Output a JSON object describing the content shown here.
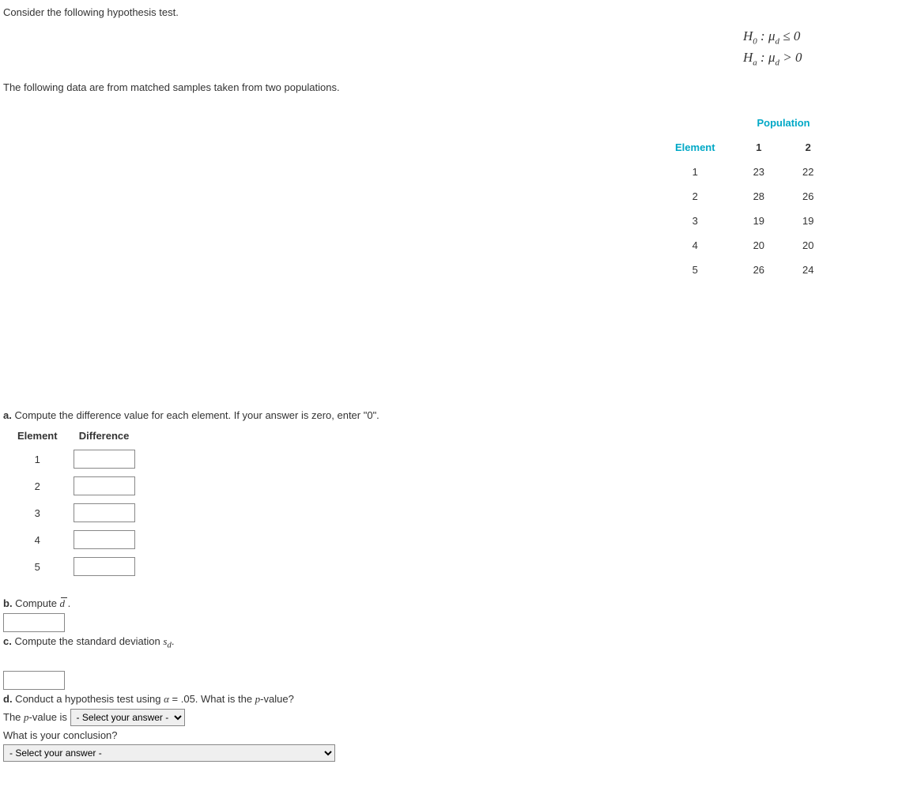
{
  "intro1": "Consider the following hypothesis test.",
  "intro2": "The following data are from matched samples taken from two populations.",
  "hypotheses": {
    "h0_prefix": "H",
    "h0_sub": "0",
    "h0_colon": " : ",
    "mu": "μ",
    "d_sub": "d",
    "h0_rel": " ≤ 0",
    "ha_prefix": "H",
    "ha_sub": "a",
    "ha_rel": " > 0"
  },
  "table": {
    "element_head": "Element",
    "population_head": "Population",
    "col1": "1",
    "col2": "2",
    "rows": [
      {
        "el": "1",
        "p1": "23",
        "p2": "22"
      },
      {
        "el": "2",
        "p1": "28",
        "p2": "26"
      },
      {
        "el": "3",
        "p1": "19",
        "p2": "19"
      },
      {
        "el": "4",
        "p1": "20",
        "p2": "20"
      },
      {
        "el": "5",
        "p1": "26",
        "p2": "24"
      }
    ]
  },
  "part_a": {
    "label": "a.",
    "text": " Compute the difference value for each element. If your answer is zero, enter \"0\".",
    "h_element": "Element",
    "h_diff": "Difference",
    "elements": [
      "1",
      "2",
      "3",
      "4",
      "5"
    ]
  },
  "part_b": {
    "label": "b.",
    "text_before": " Compute ",
    "dbar": "d",
    "text_after": " ."
  },
  "part_c": {
    "label": "c.",
    "text_before": " Compute the standard deviation ",
    "sd": "s",
    "sd_sub": "d",
    "text_after": "."
  },
  "part_d": {
    "label": "d.",
    "text1_before": " Conduct a hypothesis test using ",
    "alpha": "α",
    "eq": " = .05",
    "text1_after": ". What is the ",
    "pvar": "p",
    "text1_end": "-value?",
    "line2_before": "The ",
    "line2_mid": "-value is ",
    "select_placeholder": "- Select your answer -",
    "line3": "What is your conclusion?"
  }
}
